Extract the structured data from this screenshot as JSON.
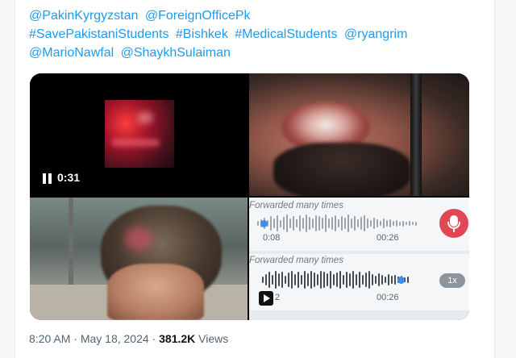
{
  "tweet": {
    "lines": [
      [
        "@PakinKyrgyzstan",
        "@ForeignOfficePk"
      ],
      [
        "#SavePakistaniStudents",
        "#Bishkek",
        "#MedicalStudents",
        "@ryangrim"
      ],
      [
        "@MarioNawfal",
        "@ShaykhSulaiman"
      ]
    ]
  },
  "media": {
    "video": {
      "time": "0:31",
      "state_icon": "pause-icon"
    },
    "voice_notes": [
      {
        "header": "Forwarded many times",
        "current": "0:08",
        "duration": "00:26",
        "action_icon": "mic-icon"
      },
      {
        "header": "Forwarded many times",
        "current": "2",
        "duration": "00:26",
        "speed": "1x",
        "action_icon": "play-icon"
      }
    ]
  },
  "meta": {
    "time": "8:20 AM",
    "separator": " · ",
    "date": "May 18, 2024",
    "views_count": "381.2K",
    "views_label": "Views"
  },
  "colors": {
    "link": "#1d9bf0",
    "mic": "#e04653",
    "progress": "#3b8ef0"
  }
}
